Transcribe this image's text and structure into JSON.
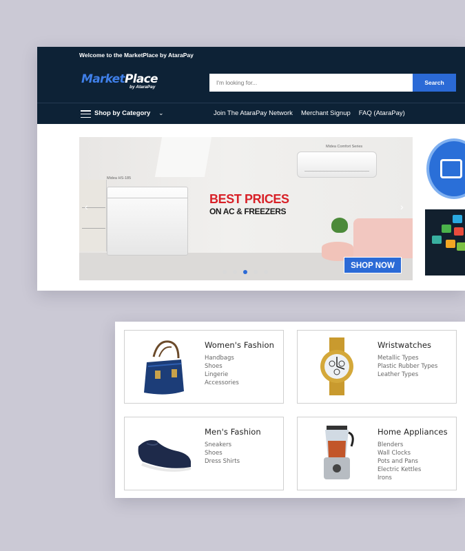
{
  "header": {
    "welcome": "Welcome to the MarketPlace by AtaraPay",
    "logo_main_a": "Market",
    "logo_main_b": "Place",
    "logo_sub": "by AtaraPay",
    "search_placeholder": "I'm looking for...",
    "search_button": "Search"
  },
  "nav": {
    "category_label": "Shop by Category",
    "links": [
      "Join The AtaraPay Network",
      "Merchant Signup",
      "FAQ (AtaraPay)"
    ]
  },
  "banner": {
    "freezer_label": "Midea HS-185",
    "ac_label": "Midea Comfort Series",
    "headline": "BEST PRICES",
    "subheadline": "ON AC & FREEZERS",
    "cta": "SHOP NOW",
    "slide_count": 5,
    "active_slide": 3
  },
  "categories": [
    {
      "title": "Women's Fashion",
      "items": [
        "Handbags",
        "Shoes",
        "Lingerie",
        "Accessories"
      ],
      "icon": "handbag-icon"
    },
    {
      "title": "Wristwatches",
      "items": [
        "Metallic Types",
        "Plastic Rubber Types",
        "Leather Types"
      ],
      "icon": "wristwatch-icon"
    },
    {
      "title": "Men's Fashion",
      "items": [
        "Sneakers",
        "Shoes",
        "Dress Shirts"
      ],
      "icon": "shoe-icon"
    },
    {
      "title": "Home Appliances",
      "items": [
        "Blenders",
        "Wall Clocks",
        "Pots and Pans",
        "Electric Kettles",
        "Irons"
      ],
      "icon": "blender-icon"
    }
  ],
  "colors": {
    "header_bg": "#0d2236",
    "accent": "#2b6ad6",
    "headline_red": "#d82027"
  }
}
